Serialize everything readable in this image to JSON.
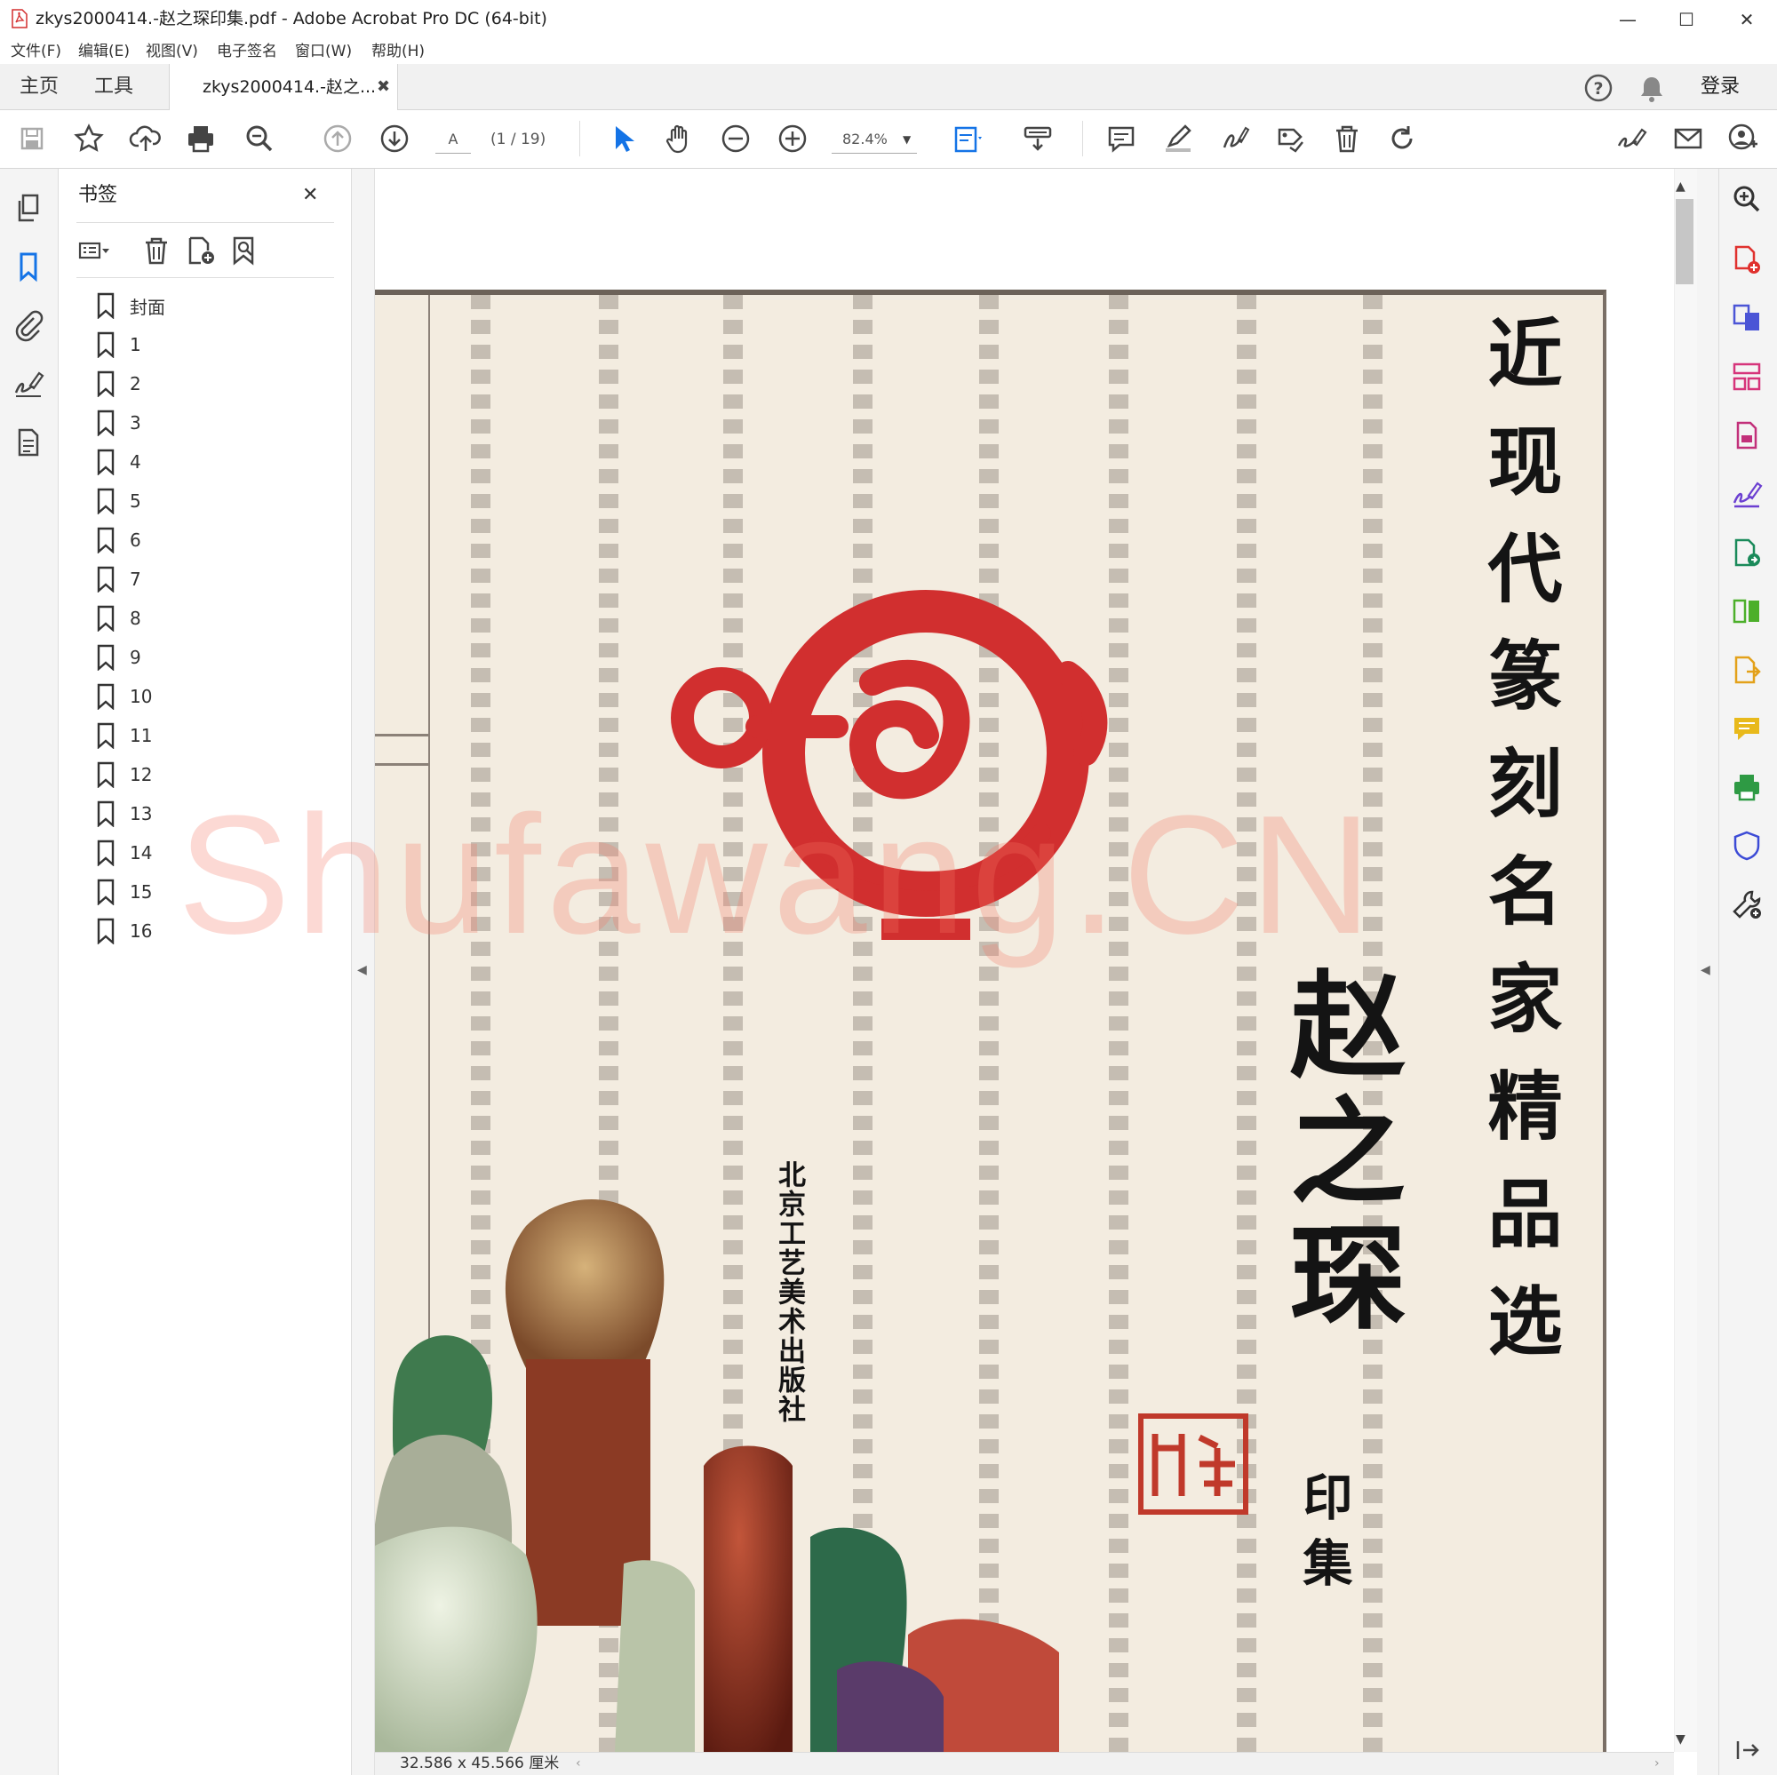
{
  "window": {
    "title": "zkys2000414.-赵之琛印集.pdf - Adobe Acrobat Pro DC (64-bit)",
    "minimize": "—",
    "maximize": "☐",
    "close": "✕"
  },
  "menu": [
    "文件(F)",
    "编辑(E)",
    "视图(V)",
    "电子签名",
    "窗口(W)",
    "帮助(H)"
  ],
  "tabs": {
    "home": "主页",
    "tools": "工具",
    "document": "zkys2000414.-赵之...",
    "document_close": "✖",
    "login": "登录"
  },
  "toolbar": {
    "page_input": "A",
    "page_count": "(1 / 19)",
    "zoom": "82.4%"
  },
  "bookmarks": {
    "title": "书签",
    "close": "✕",
    "items": [
      "封面",
      "1",
      "2",
      "3",
      "4",
      "5",
      "6",
      "7",
      "8",
      "9",
      "10",
      "11",
      "12",
      "13",
      "14",
      "15",
      "16"
    ]
  },
  "cover": {
    "title": "近现代篆刻名家精品选",
    "artist": "赵之琛",
    "subtitle": "印集",
    "publisher": "北京工艺美术出版社",
    "watermark": "Shufawang.CN"
  },
  "status": {
    "page_size": "32.586 x 45.566 厘米"
  },
  "icons": {
    "pdf": "acrobat-pdf-icon",
    "accent": "#1473e6",
    "seal_red": "#d12f2f"
  }
}
